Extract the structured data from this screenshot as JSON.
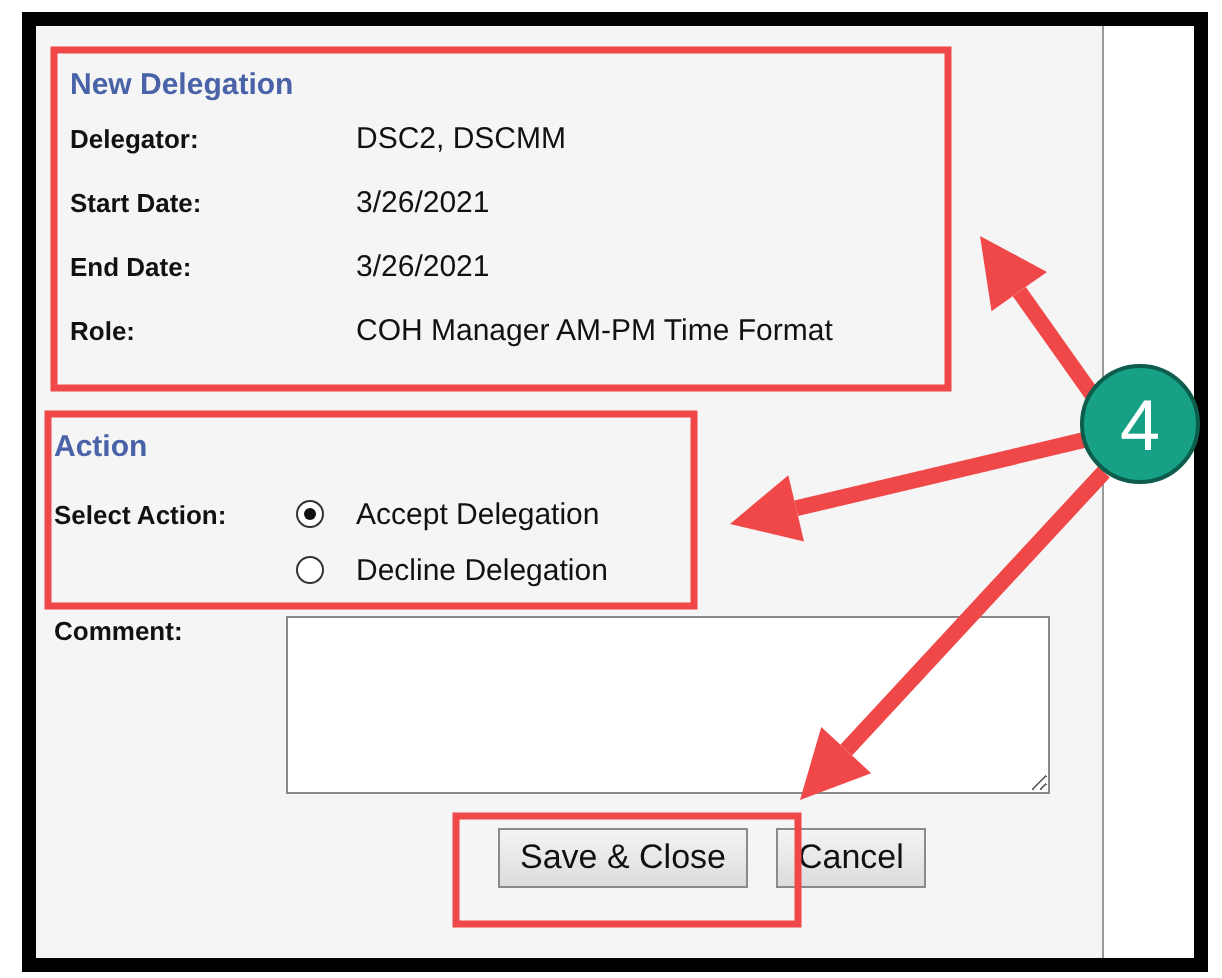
{
  "delegation": {
    "heading": "New Delegation",
    "fields": [
      {
        "label": "Delegator:",
        "value": "DSC2, DSCMM"
      },
      {
        "label": "Start Date:",
        "value": "3/26/2021"
      },
      {
        "label": "End Date:",
        "value": "3/26/2021"
      },
      {
        "label": "Role:",
        "value": "COH Manager AM-PM Time Format"
      }
    ]
  },
  "action": {
    "heading": "Action",
    "label": "Select Action:",
    "options": [
      {
        "label": "Accept Delegation",
        "selected": true
      },
      {
        "label": "Decline Delegation",
        "selected": false
      }
    ]
  },
  "comment": {
    "label": "Comment:"
  },
  "buttons": [
    {
      "label": "Save & Close"
    },
    {
      "label": "Cancel"
    }
  ],
  "annotation": {
    "callout": "4"
  }
}
